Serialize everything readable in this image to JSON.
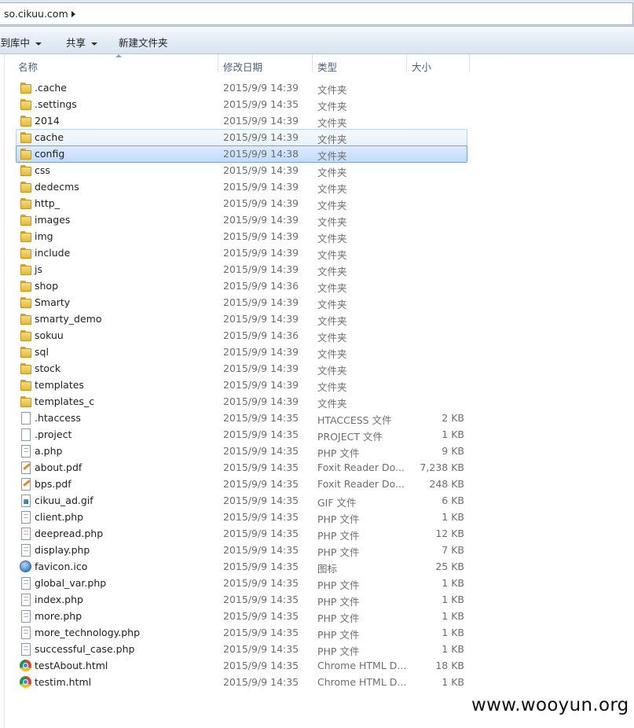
{
  "address": {
    "path": "so.cikuu.com"
  },
  "toolbar": {
    "include_library": "含到库中",
    "share": "共享",
    "new_folder": "新建文件夹"
  },
  "columns": {
    "name": "名称",
    "date": "修改日期",
    "type": "类型",
    "size": "大小"
  },
  "files": [
    {
      "name": ".cache",
      "date": "2015/9/9 14:39",
      "type": "文件夹",
      "size": "",
      "icon": "folder-icon"
    },
    {
      "name": ".settings",
      "date": "2015/9/9 14:35",
      "type": "文件夹",
      "size": "",
      "icon": "folder-icon"
    },
    {
      "name": "2014",
      "date": "2015/9/9 14:39",
      "type": "文件夹",
      "size": "",
      "icon": "folder-icon"
    },
    {
      "name": "cache",
      "date": "2015/9/9 14:39",
      "type": "文件夹",
      "size": "",
      "icon": "folder-icon"
    },
    {
      "name": "config",
      "date": "2015/9/9 14:38",
      "type": "文件夹",
      "size": "",
      "icon": "folder-icon"
    },
    {
      "name": "css",
      "date": "2015/9/9 14:39",
      "type": "文件夹",
      "size": "",
      "icon": "folder-icon"
    },
    {
      "name": "dedecms",
      "date": "2015/9/9 14:39",
      "type": "文件夹",
      "size": "",
      "icon": "folder-icon"
    },
    {
      "name": "http_",
      "date": "2015/9/9 14:39",
      "type": "文件夹",
      "size": "",
      "icon": "folder-icon"
    },
    {
      "name": "images",
      "date": "2015/9/9 14:39",
      "type": "文件夹",
      "size": "",
      "icon": "folder-icon"
    },
    {
      "name": "img",
      "date": "2015/9/9 14:39",
      "type": "文件夹",
      "size": "",
      "icon": "folder-icon"
    },
    {
      "name": "include",
      "date": "2015/9/9 14:39",
      "type": "文件夹",
      "size": "",
      "icon": "folder-icon"
    },
    {
      "name": "js",
      "date": "2015/9/9 14:39",
      "type": "文件夹",
      "size": "",
      "icon": "folder-icon"
    },
    {
      "name": "shop",
      "date": "2015/9/9 14:36",
      "type": "文件夹",
      "size": "",
      "icon": "folder-icon"
    },
    {
      "name": "Smarty",
      "date": "2015/9/9 14:39",
      "type": "文件夹",
      "size": "",
      "icon": "folder-icon"
    },
    {
      "name": "smarty_demo",
      "date": "2015/9/9 14:39",
      "type": "文件夹",
      "size": "",
      "icon": "folder-icon"
    },
    {
      "name": "sokuu",
      "date": "2015/9/9 14:36",
      "type": "文件夹",
      "size": "",
      "icon": "folder-icon"
    },
    {
      "name": "sql",
      "date": "2015/9/9 14:39",
      "type": "文件夹",
      "size": "",
      "icon": "folder-icon"
    },
    {
      "name": "stock",
      "date": "2015/9/9 14:39",
      "type": "文件夹",
      "size": "",
      "icon": "folder-icon"
    },
    {
      "name": "templates",
      "date": "2015/9/9 14:39",
      "type": "文件夹",
      "size": "",
      "icon": "folder-icon"
    },
    {
      "name": "templates_c",
      "date": "2015/9/9 14:39",
      "type": "文件夹",
      "size": "",
      "icon": "folder-icon"
    },
    {
      "name": ".htaccess",
      "date": "2015/9/9 14:35",
      "type": "HTACCESS 文件",
      "size": "2 KB",
      "icon": "blank-file-icon"
    },
    {
      "name": ".project",
      "date": "2015/9/9 14:35",
      "type": "PROJECT 文件",
      "size": "1 KB",
      "icon": "blank-file-icon"
    },
    {
      "name": "a.php",
      "date": "2015/9/9 14:35",
      "type": "PHP 文件",
      "size": "9 KB",
      "icon": "text-file-icon"
    },
    {
      "name": "about.pdf",
      "date": "2015/9/9 14:35",
      "type": "Foxit Reader Do...",
      "size": "7,238 KB",
      "icon": "pdf-file-icon"
    },
    {
      "name": "bps.pdf",
      "date": "2015/9/9 14:35",
      "type": "Foxit Reader Do...",
      "size": "248 KB",
      "icon": "pdf-file-icon"
    },
    {
      "name": "cikuu_ad.gif",
      "date": "2015/9/9 14:35",
      "type": "GIF 文件",
      "size": "6 KB",
      "icon": "image-file-icon"
    },
    {
      "name": "client.php",
      "date": "2015/9/9 14:35",
      "type": "PHP 文件",
      "size": "1 KB",
      "icon": "text-file-icon"
    },
    {
      "name": "deepread.php",
      "date": "2015/9/9 14:35",
      "type": "PHP 文件",
      "size": "12 KB",
      "icon": "text-file-icon"
    },
    {
      "name": "display.php",
      "date": "2015/9/9 14:35",
      "type": "PHP 文件",
      "size": "7 KB",
      "icon": "text-file-icon"
    },
    {
      "name": "favicon.ico",
      "date": "2015/9/9 14:35",
      "type": "图标",
      "size": "25 KB",
      "icon": "globe-icon"
    },
    {
      "name": "global_var.php",
      "date": "2015/9/9 14:35",
      "type": "PHP 文件",
      "size": "1 KB",
      "icon": "text-file-icon"
    },
    {
      "name": "index.php",
      "date": "2015/9/9 14:35",
      "type": "PHP 文件",
      "size": "1 KB",
      "icon": "text-file-icon"
    },
    {
      "name": "more.php",
      "date": "2015/9/9 14:35",
      "type": "PHP 文件",
      "size": "1 KB",
      "icon": "text-file-icon"
    },
    {
      "name": "more_technology.php",
      "date": "2015/9/9 14:35",
      "type": "PHP 文件",
      "size": "1 KB",
      "icon": "text-file-icon"
    },
    {
      "name": "successful_case.php",
      "date": "2015/9/9 14:35",
      "type": "PHP 文件",
      "size": "1 KB",
      "icon": "text-file-icon"
    },
    {
      "name": "testAbout.html",
      "date": "2015/9/9 14:35",
      "type": "Chrome HTML D...",
      "size": "18 KB",
      "icon": "chrome-icon"
    },
    {
      "name": "testim.html",
      "date": "2015/9/9 14:35",
      "type": "Chrome HTML D...",
      "size": "1 KB",
      "icon": "chrome-icon"
    }
  ],
  "hovered_item": "cache",
  "selected_item": "config",
  "watermark": "www.wooyun.org"
}
